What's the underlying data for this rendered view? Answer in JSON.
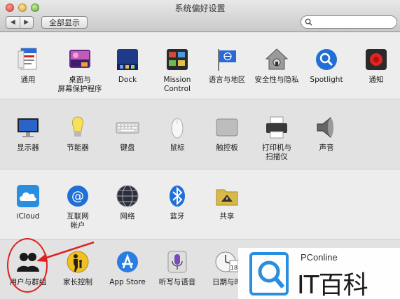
{
  "window": {
    "title": "系统偏好设置"
  },
  "toolbar": {
    "back": "◀",
    "forward": "▶",
    "show_all": "全部显示",
    "search_placeholder": ""
  },
  "rows": [
    {
      "items": [
        {
          "label": "通用",
          "icon": "file-icon"
        },
        {
          "label": "桌面与\n屏幕保护程序",
          "icon": "desktop-icon"
        },
        {
          "label": "Dock",
          "icon": "dock-icon"
        },
        {
          "label": "Mission\nControl",
          "icon": "mission-control-icon"
        },
        {
          "label": "语言与地区",
          "icon": "flag-icon"
        },
        {
          "label": "安全性与隐私",
          "icon": "house-icon"
        },
        {
          "label": "Spotlight",
          "icon": "magnifier-icon"
        },
        {
          "label": "通知",
          "icon": "notification-icon"
        }
      ]
    },
    {
      "items": [
        {
          "label": "显示器",
          "icon": "display-icon"
        },
        {
          "label": "节能器",
          "icon": "bulb-icon"
        },
        {
          "label": "键盘",
          "icon": "keyboard-icon"
        },
        {
          "label": "鼠标",
          "icon": "mouse-icon"
        },
        {
          "label": "触控板",
          "icon": "trackpad-icon"
        },
        {
          "label": "打印机与\n扫描仪",
          "icon": "printer-icon"
        },
        {
          "label": "声音",
          "icon": "speaker-icon"
        }
      ]
    },
    {
      "items": [
        {
          "label": "iCloud",
          "icon": "cloud-icon"
        },
        {
          "label": "互联网\n帐户",
          "icon": "at-icon"
        },
        {
          "label": "网络",
          "icon": "globe-icon"
        },
        {
          "label": "蓝牙",
          "icon": "bluetooth-icon"
        },
        {
          "label": "共享",
          "icon": "folder-icon"
        }
      ]
    },
    {
      "items": [
        {
          "label": "用户与群组",
          "icon": "users-icon"
        },
        {
          "label": "家长控制",
          "icon": "parental-icon"
        },
        {
          "label": "App Store",
          "icon": "appstore-icon"
        },
        {
          "label": "听写与语音",
          "icon": "microphone-icon"
        },
        {
          "label": "日期与时",
          "icon": "clock-icon"
        }
      ]
    }
  ],
  "watermark": {
    "brand": "PConline",
    "text": "IT百科"
  },
  "colors": {
    "accent_red": "#e02020",
    "spotlight_blue": "#1f6fd6"
  }
}
